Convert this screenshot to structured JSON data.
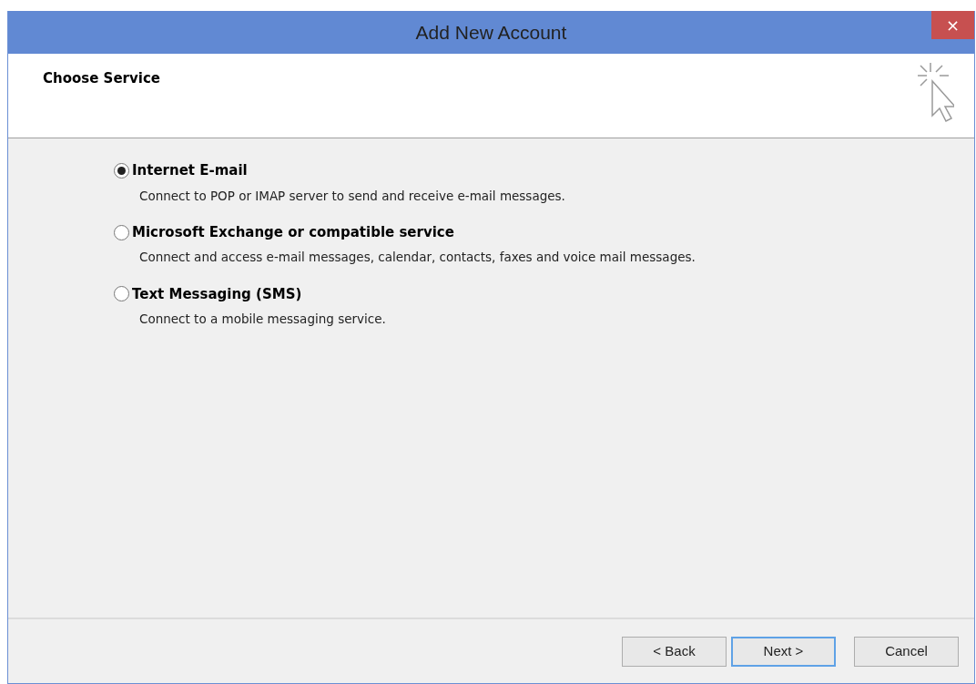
{
  "window": {
    "title": "Add New Account",
    "close": "×"
  },
  "header": {
    "title": "Choose Service"
  },
  "options": [
    {
      "label": "Internet E-mail",
      "description": "Connect to POP or IMAP server to send and receive e-mail messages.",
      "selected": true
    },
    {
      "label": "Microsoft Exchange or compatible service",
      "description": "Connect and access e-mail messages, calendar, contacts, faxes and voice mail messages.",
      "selected": false
    },
    {
      "label": "Text Messaging (SMS)",
      "description": "Connect to a mobile messaging service.",
      "selected": false
    }
  ],
  "buttons": [
    {
      "label": "< Back",
      "default": false
    },
    {
      "label": "Next >",
      "default": true
    },
    {
      "label": "Cancel",
      "default": false
    }
  ]
}
